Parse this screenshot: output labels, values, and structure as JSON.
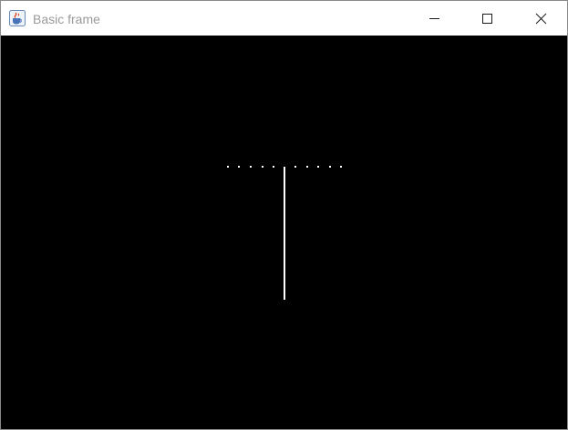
{
  "window": {
    "title": "Basic frame",
    "app_icon": "java-coffee-cup-icon",
    "controls": {
      "minimize_icon": "minimize-icon",
      "maximize_icon": "maximize-icon",
      "close_icon": "close-icon"
    }
  },
  "canvas": {
    "background_color": "#000000",
    "drawing_color": "#ffffff"
  }
}
